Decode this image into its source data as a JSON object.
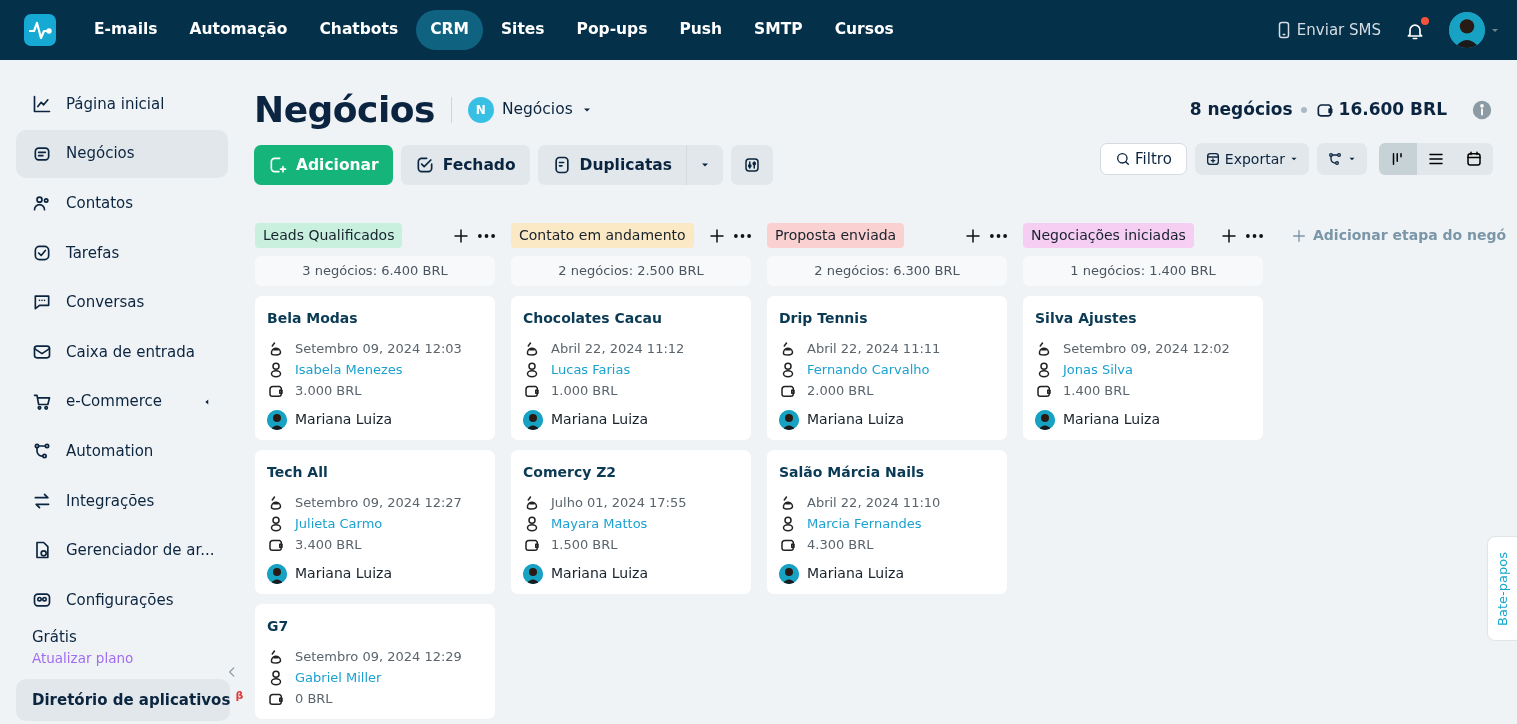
{
  "topbar": {
    "nav": [
      {
        "label": "E-mails",
        "selected": false
      },
      {
        "label": "Automação",
        "selected": false
      },
      {
        "label": "Chatbots",
        "selected": false
      },
      {
        "label": "CRM",
        "selected": true
      },
      {
        "label": "Sites",
        "selected": false
      },
      {
        "label": "Pop-ups",
        "selected": false
      },
      {
        "label": "Push",
        "selected": false
      },
      {
        "label": "SMTP",
        "selected": false
      },
      {
        "label": "Cursos",
        "selected": false
      }
    ],
    "sms_label": "Enviar SMS",
    "notifications_unread": true
  },
  "sidebar": {
    "items": [
      {
        "label": "Página inicial",
        "selected": false,
        "has_submenu": false
      },
      {
        "label": "Negócios",
        "selected": true,
        "has_submenu": false
      },
      {
        "label": "Contatos",
        "selected": false,
        "has_submenu": false
      },
      {
        "label": "Tarefas",
        "selected": false,
        "has_submenu": false
      },
      {
        "label": "Conversas",
        "selected": false,
        "has_submenu": false
      },
      {
        "label": "Caixa de entrada",
        "selected": false,
        "has_submenu": false
      },
      {
        "label": "e-Commerce",
        "selected": false,
        "has_submenu": true
      },
      {
        "label": "Automation",
        "selected": false,
        "has_submenu": false
      },
      {
        "label": "Integrações",
        "selected": false,
        "has_submenu": false
      },
      {
        "label": "Gerenciador de ar...",
        "selected": false,
        "has_submenu": false
      },
      {
        "label": "Configurações",
        "selected": false,
        "has_submenu": false
      }
    ],
    "plan": "Grátis",
    "upgrade_link": "Atualizar plano",
    "app_directory": "Diretório de aplicativos",
    "app_directory_badge": "β"
  },
  "header": {
    "title": "Negócios",
    "pipeline_initial": "N",
    "pipeline_name": "Negócios",
    "deal_count": "8 negócios",
    "total": "16.600 BRL"
  },
  "toolbar": {
    "add": "Adicionar",
    "closed": "Fechado",
    "duplicates": "Duplicatas",
    "filter": "Filtro",
    "export": "Exportar",
    "views": [
      {
        "selected": true
      },
      {
        "selected": false
      },
      {
        "selected": false
      }
    ]
  },
  "stages": [
    {
      "name": "Leads Qualificados",
      "color": "#c9f0de",
      "summary": "3 negócios: 6.400 BRL",
      "deals": [
        {
          "title": "Bela Modas",
          "date": "Setembro 09, 2024 12:03",
          "contact": "Isabela Menezes",
          "value": "3.000 BRL",
          "owner": "Mariana Luiza"
        },
        {
          "title": "Tech All",
          "date": "Setembro 09, 2024 12:27",
          "contact": "Julieta Carmo",
          "value": "3.400 BRL",
          "owner": "Mariana Luiza"
        },
        {
          "title": "G7",
          "date": "Setembro 09, 2024 12:29",
          "contact": "Gabriel Miller",
          "value": "0 BRL"
        }
      ]
    },
    {
      "name": "Contato em andamento",
      "color": "#fbe8c4",
      "summary": "2 negócios: 2.500 BRL",
      "deals": [
        {
          "title": "Chocolates Cacau",
          "date": "Abril 22, 2024 11:12",
          "contact": "Lucas Farias",
          "value": "1.000 BRL",
          "owner": "Mariana Luiza"
        },
        {
          "title": "Comercy Z2",
          "date": "Julho 01, 2024 17:55",
          "contact": "Mayara Mattos",
          "value": "1.500 BRL",
          "owner": "Mariana Luiza"
        }
      ]
    },
    {
      "name": "Proposta enviada",
      "color": "#fbd0d0",
      "summary": "2 negócios: 6.300 BRL",
      "deals": [
        {
          "title": "Drip Tennis",
          "date": "Abril 22, 2024 11:11",
          "contact": "Fernando Carvalho",
          "value": "2.000 BRL",
          "owner": "Mariana Luiza"
        },
        {
          "title": "Salão Márcia Nails",
          "date": "Abril 22, 2024 11:10",
          "contact": "Marcia Fernandes",
          "value": "4.300 BRL",
          "owner": "Mariana Luiza"
        }
      ]
    },
    {
      "name": "Negociações iniciadas",
      "color": "#f6cdf3",
      "summary": "1 negócios: 1.400 BRL",
      "deals": [
        {
          "title": "Silva Ajustes",
          "date": "Setembro 09, 2024 12:02",
          "contact": "Jonas Silva",
          "value": "1.400 BRL",
          "owner": "Mariana Luiza"
        }
      ]
    }
  ],
  "add_stage": "Adicionar etapa do negó",
  "chat_tab": "Bate-papos"
}
